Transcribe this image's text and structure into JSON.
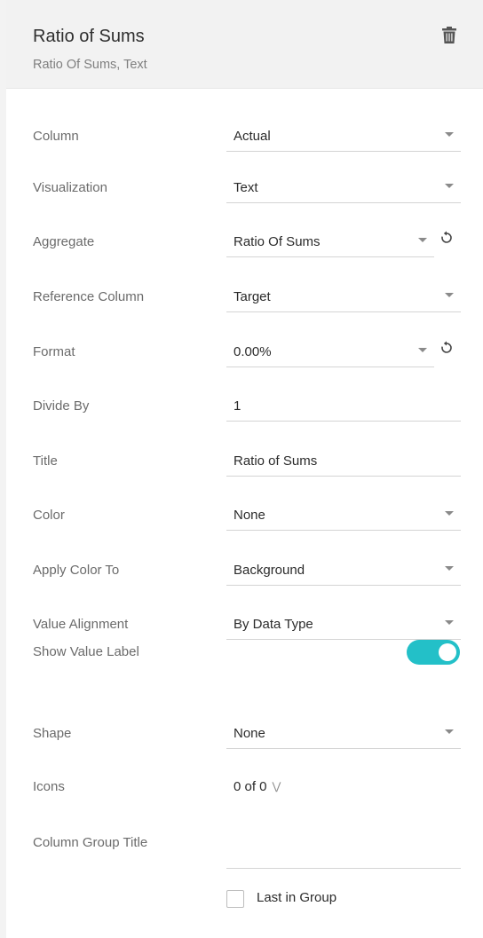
{
  "header": {
    "title": "Ratio of Sums",
    "subtitle": "Ratio Of Sums, Text",
    "delete_icon": "trash-icon"
  },
  "rows": {
    "column": {
      "label": "Column",
      "value": "Actual"
    },
    "visualization": {
      "label": "Visualization",
      "value": "Text"
    },
    "aggregate": {
      "label": "Aggregate",
      "value": "Ratio Of Sums",
      "reset_icon": "reset-icon"
    },
    "reference_column": {
      "label": "Reference Column",
      "value": "Target"
    },
    "format": {
      "label": "Format",
      "value": "0.00%",
      "reset_icon": "reset-icon"
    },
    "divide_by": {
      "label": "Divide By",
      "value": "1"
    },
    "title": {
      "label": "Title",
      "value": "Ratio of Sums"
    },
    "color": {
      "label": "Color",
      "value": "None"
    },
    "apply_color_to": {
      "label": "Apply Color To",
      "value": "Background"
    },
    "value_alignment": {
      "label": "Value Alignment",
      "value": "By Data Type"
    },
    "show_value_label": {
      "label": "Show Value Label",
      "enabled": true
    },
    "shape": {
      "label": "Shape",
      "value": "None"
    },
    "icons": {
      "label": "Icons",
      "value": "0 of 0",
      "expand_icon": "chevrons-down-icon"
    },
    "column_group_title": {
      "label": "Column Group Title",
      "value": ""
    }
  },
  "last_in_group": {
    "label": "Last in Group",
    "checked": false
  },
  "colors": {
    "header_bg": "#f2f2f2",
    "toggle_on": "#23c0c8",
    "label_text": "#6b6b6b",
    "value_text": "#2b2b2b",
    "underline": "#d4d4d4"
  }
}
